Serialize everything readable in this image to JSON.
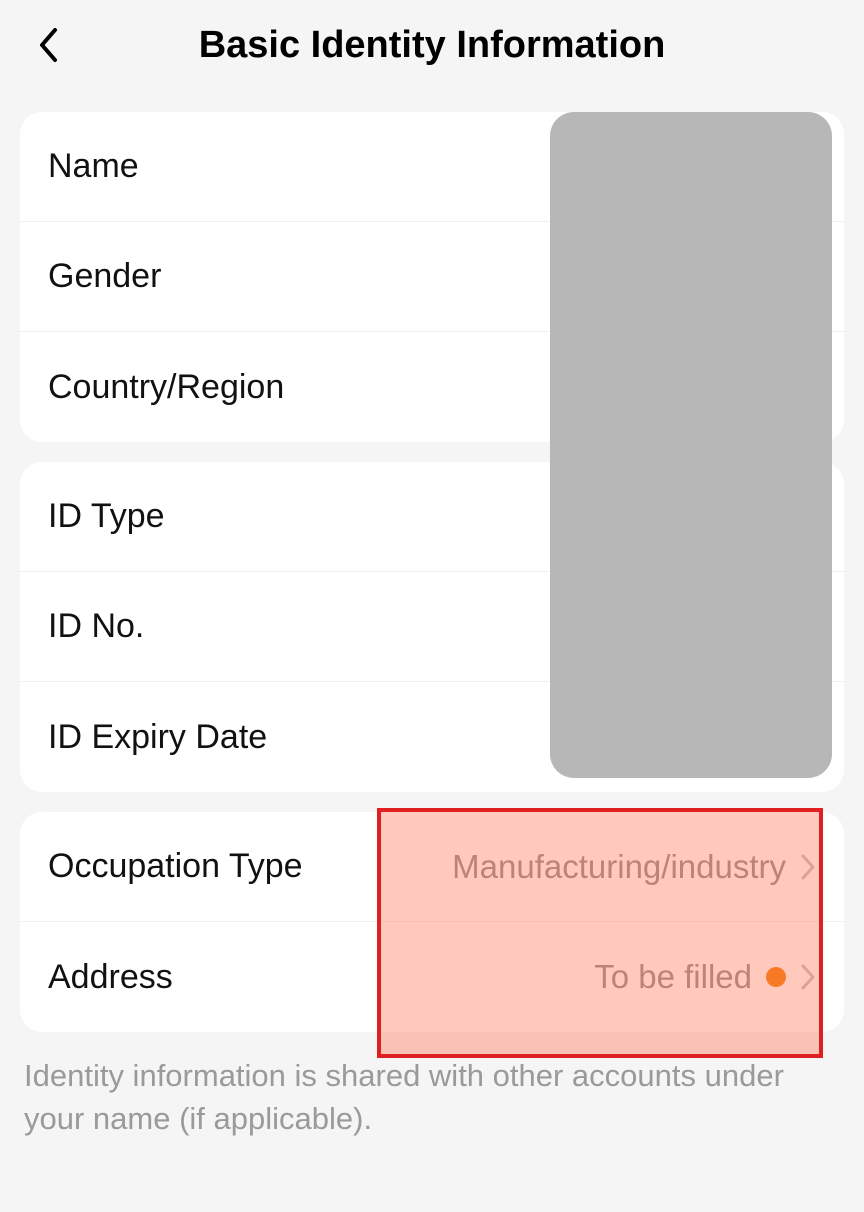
{
  "header": {
    "title": "Basic Identity Information"
  },
  "groups": [
    {
      "rows": [
        {
          "label": "Name"
        },
        {
          "label": "Gender"
        },
        {
          "label": "Country/Region"
        }
      ]
    },
    {
      "rows": [
        {
          "label": "ID Type"
        },
        {
          "label": "ID No."
        },
        {
          "label": "ID Expiry Date"
        }
      ]
    },
    {
      "rows": [
        {
          "label": "Occupation Type",
          "value": "Manufacturing/industry",
          "chevron": true
        },
        {
          "label": "Address",
          "value": "To be filled",
          "dot": true,
          "chevron": true
        }
      ]
    }
  ],
  "footer": "Identity information is shared with other accounts under your name (if applicable)."
}
